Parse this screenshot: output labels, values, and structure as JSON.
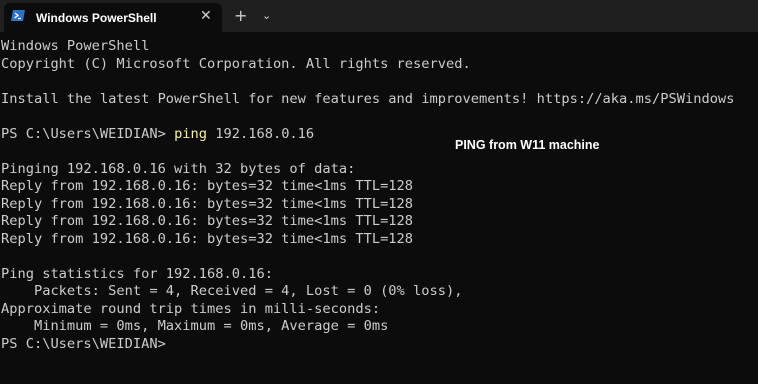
{
  "window": {
    "tab_title": "Windows PowerShell",
    "tab_close_glyph": "✕",
    "new_tab_glyph": "+",
    "tab_dropdown_glyph": "⌄"
  },
  "terminal": {
    "lines": [
      "Windows PowerShell",
      "Copyright (C) Microsoft Corporation. All rights reserved.",
      "",
      "Install the latest PowerShell for new features and improvements! https://aka.ms/PSWindows",
      "",
      "",
      "",
      "Pinging 192.168.0.16 with 32 bytes of data:",
      "Reply from 192.168.0.16: bytes=32 time<1ms TTL=128",
      "Reply from 192.168.0.16: bytes=32 time<1ms TTL=128",
      "Reply from 192.168.0.16: bytes=32 time<1ms TTL=128",
      "Reply from 192.168.0.16: bytes=32 time<1ms TTL=128",
      "",
      "Ping statistics for 192.168.0.16:",
      "    Packets: Sent = 4, Received = 4, Lost = 0 (0% loss),",
      "Approximate round trip times in milli-seconds:",
      "    Minimum = 0ms, Maximum = 0ms, Average = 0ms",
      "PS C:\\Users\\WEIDIAN>"
    ],
    "prompt_line": {
      "prompt": "PS C:\\Users\\WEIDIAN> ",
      "command": "ping",
      "args": " 192.168.0.16"
    }
  },
  "annotation": "PING from W11 machine",
  "colors": {
    "background": "#0c0c0c",
    "titlebar": "#1f1f1f",
    "text": "#cccccc",
    "command": "#f9f1a5",
    "powershell_icon": "#2f73c8"
  },
  "icons": {
    "tab_icon": "powershell-icon"
  }
}
